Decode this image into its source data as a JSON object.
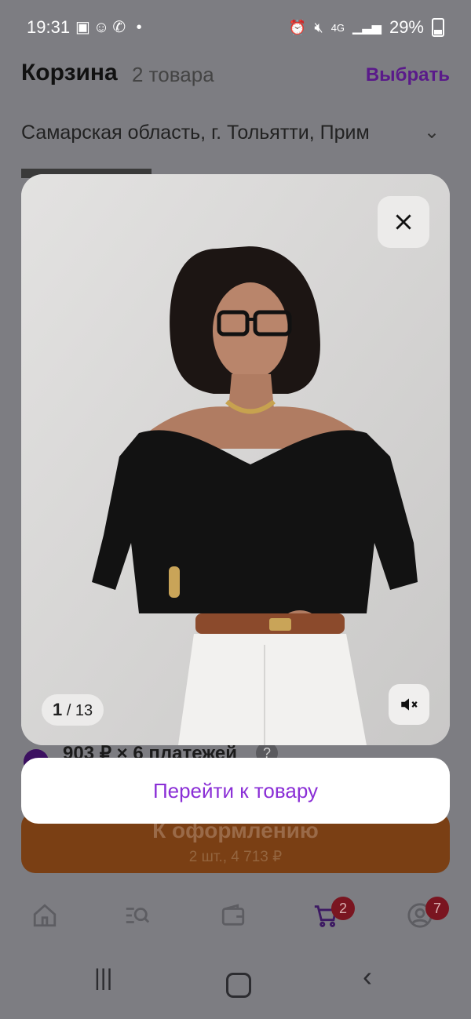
{
  "status_bar": {
    "time": "19:31",
    "battery": "29%",
    "network": "4G"
  },
  "page": {
    "title": "Корзина",
    "count": "2 товара",
    "select_label": "Выбрать",
    "address": "Самарская область, г. Тольятти, Прим"
  },
  "installments": {
    "text": "903 ₽ × 6 платежей",
    "help": "?"
  },
  "checkout": {
    "label": "К оформлению",
    "sub": "2 шт., 4 713 ₽"
  },
  "bottom_nav": {
    "cart_badge": "2",
    "profile_badge": "7"
  },
  "modal": {
    "counter_current": "1",
    "counter_total": "/ 13",
    "goto_label": "Перейти к товару"
  }
}
